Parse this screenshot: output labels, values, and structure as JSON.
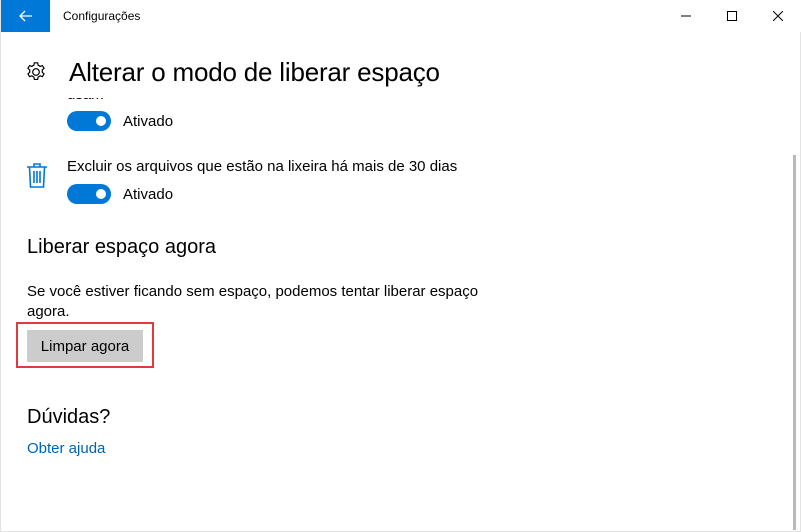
{
  "window": {
    "title": "Configurações",
    "accent": "#0078d7"
  },
  "header": {
    "title": "Alterar o modo de liberar espaço",
    "icon": "gear-icon"
  },
  "settings": {
    "cut_text": "usam",
    "toggle1_label": "Ativado",
    "toggle1_on": true,
    "recycle_desc": "Excluir os arquivos que estão na lixeira há mais de 30 dias",
    "recycle_icon": "trash-icon",
    "toggle2_label": "Ativado",
    "toggle2_on": true
  },
  "free_now": {
    "heading": "Liberar espaço agora",
    "description": "Se você estiver ficando sem espaço, podemos tentar liberar espaço agora.",
    "button_label": "Limpar agora",
    "highlight_color": "#e03a3e"
  },
  "help": {
    "heading": "Dúvidas?",
    "link": "Obter ajuda",
    "link_color": "#0063b1"
  }
}
